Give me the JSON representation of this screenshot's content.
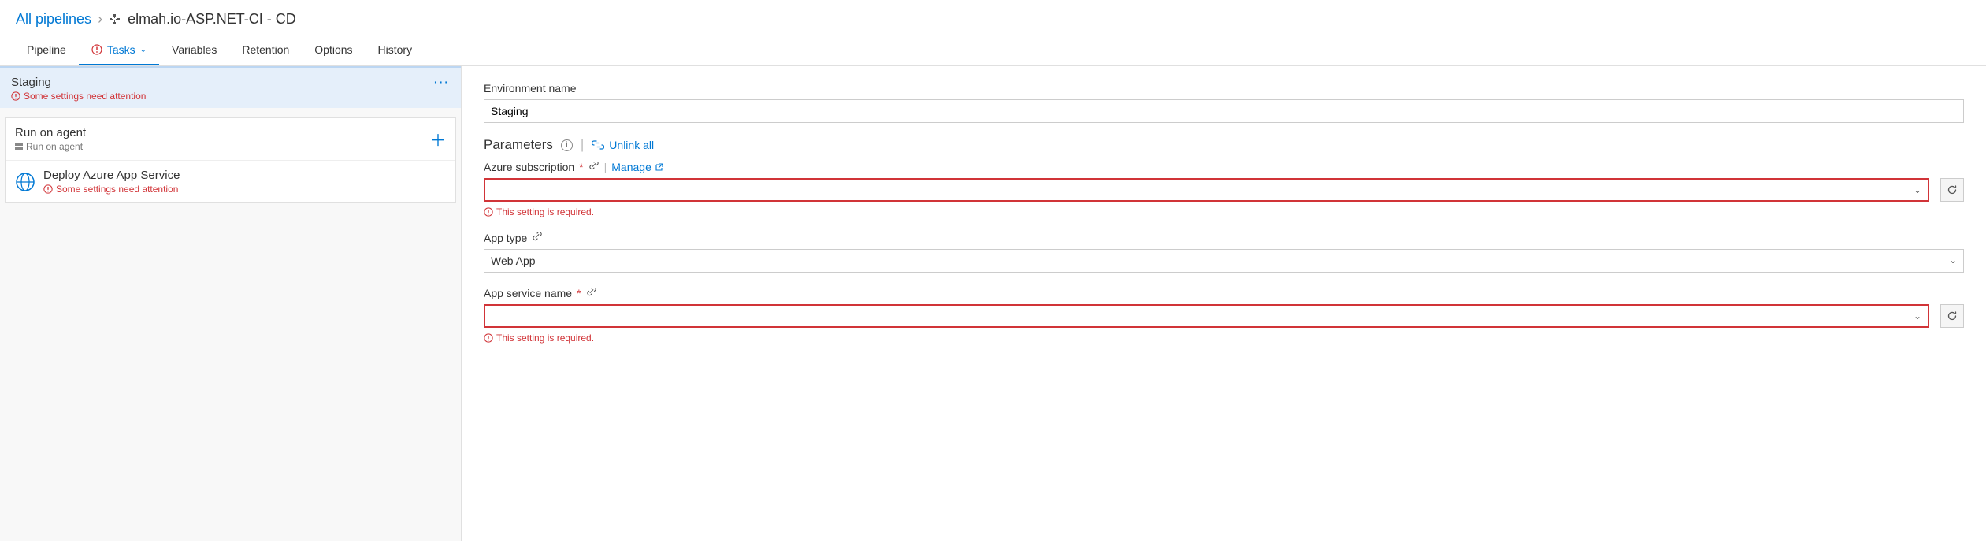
{
  "breadcrumb": {
    "root": "All pipelines",
    "title": "elmah.io-ASP.NET-CI - CD"
  },
  "tabs": {
    "pipeline": "Pipeline",
    "tasks": "Tasks",
    "variables": "Variables",
    "retention": "Retention",
    "options": "Options",
    "history": "History"
  },
  "stage": {
    "name": "Staging",
    "warning": "Some settings need attention"
  },
  "agent": {
    "title": "Run on agent",
    "subtitle": "Run on agent"
  },
  "task": {
    "title": "Deploy Azure App Service",
    "warning": "Some settings need attention"
  },
  "form": {
    "env_label": "Environment name",
    "env_value": "Staging",
    "params_heading": "Parameters",
    "unlink_label": "Unlink all",
    "azure_label": "Azure subscription",
    "manage_label": "Manage",
    "required_msg": "This setting is required.",
    "app_type_label": "App type",
    "app_type_value": "Web App",
    "app_service_label": "App service name"
  }
}
